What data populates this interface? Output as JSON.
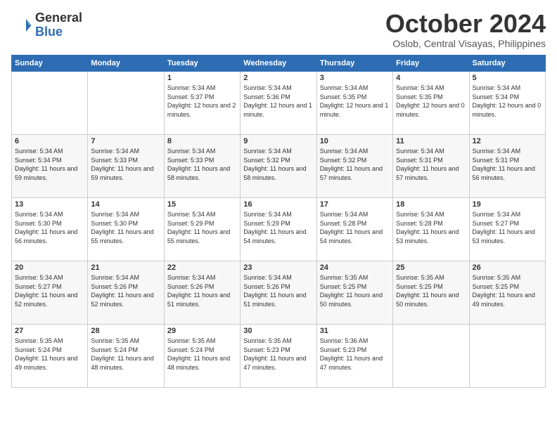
{
  "logo": {
    "general": "General",
    "blue": "Blue"
  },
  "title": "October 2024",
  "subtitle": "Oslob, Central Visayas, Philippines",
  "days_of_week": [
    "Sunday",
    "Monday",
    "Tuesday",
    "Wednesday",
    "Thursday",
    "Friday",
    "Saturday"
  ],
  "weeks": [
    [
      {
        "day": "",
        "info": ""
      },
      {
        "day": "",
        "info": ""
      },
      {
        "day": "1",
        "info": "Sunrise: 5:34 AM\nSunset: 5:37 PM\nDaylight: 12 hours and 2 minutes."
      },
      {
        "day": "2",
        "info": "Sunrise: 5:34 AM\nSunset: 5:36 PM\nDaylight: 12 hours and 1 minute."
      },
      {
        "day": "3",
        "info": "Sunrise: 5:34 AM\nSunset: 5:35 PM\nDaylight: 12 hours and 1 minute."
      },
      {
        "day": "4",
        "info": "Sunrise: 5:34 AM\nSunset: 5:35 PM\nDaylight: 12 hours and 0 minutes."
      },
      {
        "day": "5",
        "info": "Sunrise: 5:34 AM\nSunset: 5:34 PM\nDaylight: 12 hours and 0 minutes."
      }
    ],
    [
      {
        "day": "6",
        "info": "Sunrise: 5:34 AM\nSunset: 5:34 PM\nDaylight: 11 hours and 59 minutes."
      },
      {
        "day": "7",
        "info": "Sunrise: 5:34 AM\nSunset: 5:33 PM\nDaylight: 11 hours and 59 minutes."
      },
      {
        "day": "8",
        "info": "Sunrise: 5:34 AM\nSunset: 5:33 PM\nDaylight: 11 hours and 58 minutes."
      },
      {
        "day": "9",
        "info": "Sunrise: 5:34 AM\nSunset: 5:32 PM\nDaylight: 11 hours and 58 minutes."
      },
      {
        "day": "10",
        "info": "Sunrise: 5:34 AM\nSunset: 5:32 PM\nDaylight: 11 hours and 57 minutes."
      },
      {
        "day": "11",
        "info": "Sunrise: 5:34 AM\nSunset: 5:31 PM\nDaylight: 11 hours and 57 minutes."
      },
      {
        "day": "12",
        "info": "Sunrise: 5:34 AM\nSunset: 5:31 PM\nDaylight: 11 hours and 56 minutes."
      }
    ],
    [
      {
        "day": "13",
        "info": "Sunrise: 5:34 AM\nSunset: 5:30 PM\nDaylight: 11 hours and 56 minutes."
      },
      {
        "day": "14",
        "info": "Sunrise: 5:34 AM\nSunset: 5:30 PM\nDaylight: 11 hours and 55 minutes."
      },
      {
        "day": "15",
        "info": "Sunrise: 5:34 AM\nSunset: 5:29 PM\nDaylight: 11 hours and 55 minutes."
      },
      {
        "day": "16",
        "info": "Sunrise: 5:34 AM\nSunset: 5:29 PM\nDaylight: 11 hours and 54 minutes."
      },
      {
        "day": "17",
        "info": "Sunrise: 5:34 AM\nSunset: 5:28 PM\nDaylight: 11 hours and 54 minutes."
      },
      {
        "day": "18",
        "info": "Sunrise: 5:34 AM\nSunset: 5:28 PM\nDaylight: 11 hours and 53 minutes."
      },
      {
        "day": "19",
        "info": "Sunrise: 5:34 AM\nSunset: 5:27 PM\nDaylight: 11 hours and 53 minutes."
      }
    ],
    [
      {
        "day": "20",
        "info": "Sunrise: 5:34 AM\nSunset: 5:27 PM\nDaylight: 11 hours and 52 minutes."
      },
      {
        "day": "21",
        "info": "Sunrise: 5:34 AM\nSunset: 5:26 PM\nDaylight: 11 hours and 52 minutes."
      },
      {
        "day": "22",
        "info": "Sunrise: 5:34 AM\nSunset: 5:26 PM\nDaylight: 11 hours and 51 minutes."
      },
      {
        "day": "23",
        "info": "Sunrise: 5:34 AM\nSunset: 5:26 PM\nDaylight: 11 hours and 51 minutes."
      },
      {
        "day": "24",
        "info": "Sunrise: 5:35 AM\nSunset: 5:25 PM\nDaylight: 11 hours and 50 minutes."
      },
      {
        "day": "25",
        "info": "Sunrise: 5:35 AM\nSunset: 5:25 PM\nDaylight: 11 hours and 50 minutes."
      },
      {
        "day": "26",
        "info": "Sunrise: 5:35 AM\nSunset: 5:25 PM\nDaylight: 11 hours and 49 minutes."
      }
    ],
    [
      {
        "day": "27",
        "info": "Sunrise: 5:35 AM\nSunset: 5:24 PM\nDaylight: 11 hours and 49 minutes."
      },
      {
        "day": "28",
        "info": "Sunrise: 5:35 AM\nSunset: 5:24 PM\nDaylight: 11 hours and 48 minutes."
      },
      {
        "day": "29",
        "info": "Sunrise: 5:35 AM\nSunset: 5:24 PM\nDaylight: 11 hours and 48 minutes."
      },
      {
        "day": "30",
        "info": "Sunrise: 5:35 AM\nSunset: 5:23 PM\nDaylight: 11 hours and 47 minutes."
      },
      {
        "day": "31",
        "info": "Sunrise: 5:36 AM\nSunset: 5:23 PM\nDaylight: 11 hours and 47 minutes."
      },
      {
        "day": "",
        "info": ""
      },
      {
        "day": "",
        "info": ""
      }
    ]
  ]
}
